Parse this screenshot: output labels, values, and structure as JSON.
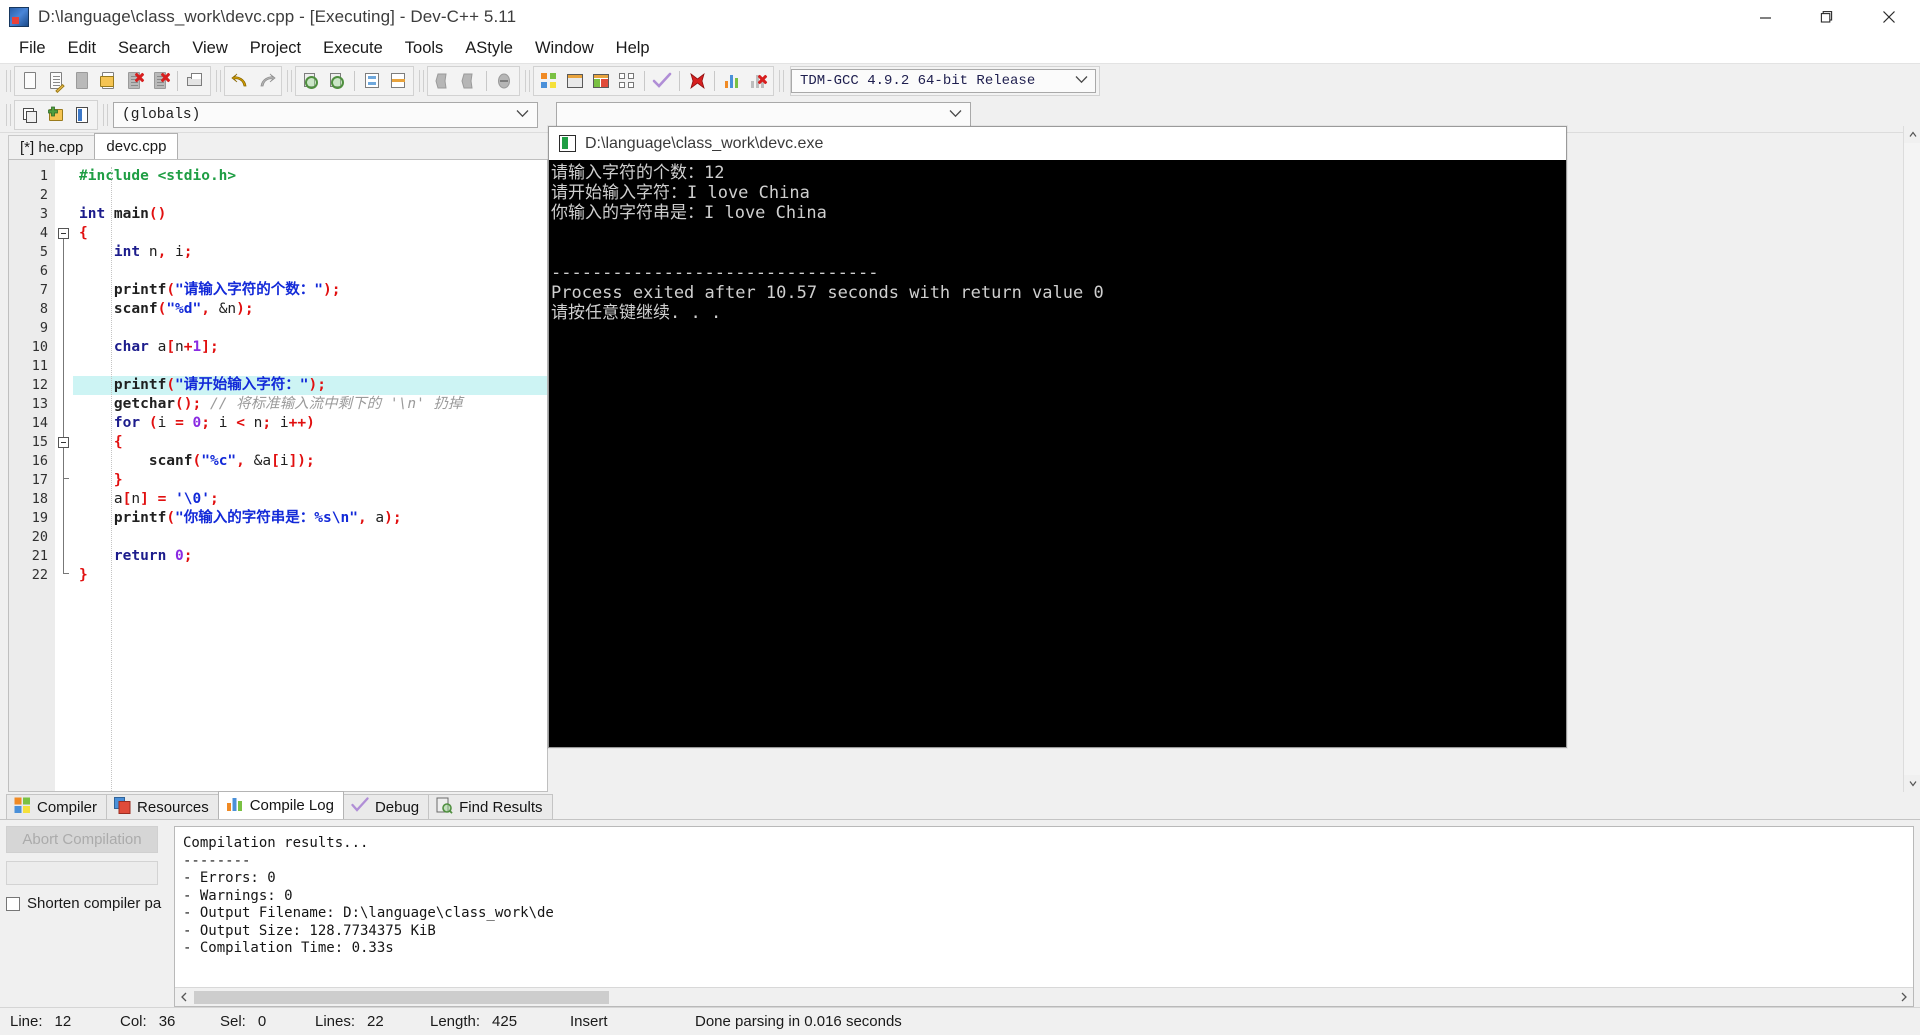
{
  "window": {
    "title": "D:\\language\\class_work\\devc.cpp - [Executing] - Dev-C++ 5.11",
    "app_icon": "devcpp-icon",
    "minimize": "minimize-icon",
    "maximize": "restore-icon",
    "close": "close-icon"
  },
  "menu": {
    "items": [
      "File",
      "Edit",
      "Search",
      "View",
      "Project",
      "Execute",
      "Tools",
      "AStyle",
      "Window",
      "Help"
    ]
  },
  "toolbar": {
    "groups": [
      {
        "buttons": [
          {
            "name": "new-file-icon"
          },
          {
            "name": "open-file-icon"
          },
          {
            "name": "save-file-icon"
          },
          {
            "name": "save-as-icon"
          },
          {
            "name": "close-file-icon"
          },
          {
            "name": "close-all-icon"
          },
          {
            "name": "print-icon"
          }
        ]
      },
      {
        "buttons": [
          {
            "name": "undo-icon"
          },
          {
            "name": "redo-icon"
          }
        ]
      },
      {
        "buttons": [
          {
            "name": "find-icon"
          },
          {
            "name": "replace-icon"
          },
          {
            "name": "goto-line-icon"
          },
          {
            "name": "toggle-breakpoint-icon"
          }
        ]
      },
      {
        "buttons": [
          {
            "name": "back-icon"
          },
          {
            "name": "forward-icon"
          },
          {
            "name": "insert-icon"
          }
        ]
      },
      {
        "buttons": [
          {
            "name": "compile-icon"
          },
          {
            "name": "run-icon"
          },
          {
            "name": "compile-run-icon"
          },
          {
            "name": "rebuild-all-icon"
          },
          {
            "name": "syntax-check-icon"
          },
          {
            "name": "stop-execution-icon"
          },
          {
            "name": "profile-icon"
          },
          {
            "name": "delete-profile-icon"
          }
        ]
      }
    ],
    "compiler_select": {
      "value": "TDM-GCC 4.9.2 64-bit Release",
      "chevron": "chevron-down-icon"
    }
  },
  "toolbar2": {
    "buttons": [
      {
        "name": "project-manager-icon"
      },
      {
        "name": "add-to-project-icon"
      },
      {
        "name": "class-browser-icon"
      }
    ],
    "scope_select": {
      "value": "(globals)",
      "chevron": "chevron-down-icon"
    },
    "member_select": {
      "value": "",
      "chevron": "chevron-down-icon"
    }
  },
  "editor": {
    "tabs": [
      {
        "label": "[*] he.cpp",
        "active": false
      },
      {
        "label": "devc.cpp",
        "active": true
      }
    ],
    "highlighted_line": 12,
    "total_lines": 22,
    "lines": [
      {
        "n": 1,
        "tokens": [
          {
            "t": "#include <stdio.h>",
            "c": "pp"
          }
        ]
      },
      {
        "n": 2,
        "tokens": []
      },
      {
        "n": 3,
        "tokens": [
          {
            "t": "int",
            "c": "k"
          },
          {
            "t": " main",
            "c": "fn"
          },
          {
            "t": "()",
            "c": "pun"
          }
        ]
      },
      {
        "n": 4,
        "tokens": [
          {
            "t": "{",
            "c": "pun"
          }
        ],
        "fold": "start"
      },
      {
        "n": 5,
        "tokens": [
          {
            "t": "    ",
            "c": "id"
          },
          {
            "t": "int",
            "c": "k"
          },
          {
            "t": " n",
            "c": "id"
          },
          {
            "t": ",",
            "c": "pun"
          },
          {
            "t": " i",
            "c": "id"
          },
          {
            "t": ";",
            "c": "pun"
          }
        ]
      },
      {
        "n": 6,
        "tokens": []
      },
      {
        "n": 7,
        "tokens": [
          {
            "t": "    printf",
            "c": "fn"
          },
          {
            "t": "(",
            "c": "pun"
          },
          {
            "t": "\"请输入字符的个数：\"",
            "c": "str"
          },
          {
            "t": ");",
            "c": "pun"
          }
        ]
      },
      {
        "n": 8,
        "tokens": [
          {
            "t": "    scanf",
            "c": "fn"
          },
          {
            "t": "(",
            "c": "pun"
          },
          {
            "t": "\"%d\"",
            "c": "str"
          },
          {
            "t": ",",
            "c": "pun"
          },
          {
            "t": " &n",
            "c": "id"
          },
          {
            "t": ");",
            "c": "pun"
          }
        ]
      },
      {
        "n": 9,
        "tokens": []
      },
      {
        "n": 10,
        "tokens": [
          {
            "t": "    ",
            "c": "id"
          },
          {
            "t": "char",
            "c": "k"
          },
          {
            "t": " a",
            "c": "id"
          },
          {
            "t": "[",
            "c": "pun"
          },
          {
            "t": "n",
            "c": "id"
          },
          {
            "t": "+",
            "c": "pun"
          },
          {
            "t": "1",
            "c": "num"
          },
          {
            "t": "];",
            "c": "pun"
          }
        ]
      },
      {
        "n": 11,
        "tokens": []
      },
      {
        "n": 12,
        "tokens": [
          {
            "t": "    printf",
            "c": "fn"
          },
          {
            "t": "(",
            "c": "pun"
          },
          {
            "t": "\"请开始输入字符：\"",
            "c": "str"
          },
          {
            "t": ");",
            "c": "pun"
          }
        ]
      },
      {
        "n": 13,
        "tokens": [
          {
            "t": "    getchar",
            "c": "fn"
          },
          {
            "t": "();",
            "c": "pun"
          },
          {
            "t": " // 将标准输入流中剩下的 '\\n' 扔掉",
            "c": "cm"
          }
        ]
      },
      {
        "n": 14,
        "tokens": [
          {
            "t": "    ",
            "c": "id"
          },
          {
            "t": "for",
            "c": "k"
          },
          {
            "t": " (",
            "c": "pun"
          },
          {
            "t": "i ",
            "c": "id"
          },
          {
            "t": "=",
            "c": "pun"
          },
          {
            "t": " ",
            "c": "id"
          },
          {
            "t": "0",
            "c": "num"
          },
          {
            "t": ";",
            "c": "pun"
          },
          {
            "t": " i ",
            "c": "id"
          },
          {
            "t": "<",
            "c": "pun"
          },
          {
            "t": " n",
            "c": "id"
          },
          {
            "t": ";",
            "c": "pun"
          },
          {
            "t": " i",
            "c": "id"
          },
          {
            "t": "++)",
            "c": "pun"
          }
        ]
      },
      {
        "n": 15,
        "tokens": [
          {
            "t": "    ",
            "c": "id"
          },
          {
            "t": "{",
            "c": "pun"
          }
        ],
        "fold": "start"
      },
      {
        "n": 16,
        "tokens": [
          {
            "t": "        scanf",
            "c": "fn"
          },
          {
            "t": "(",
            "c": "pun"
          },
          {
            "t": "\"%c\"",
            "c": "str"
          },
          {
            "t": ",",
            "c": "pun"
          },
          {
            "t": " &a",
            "c": "id"
          },
          {
            "t": "[",
            "c": "pun"
          },
          {
            "t": "i",
            "c": "id"
          },
          {
            "t": "]);",
            "c": "pun"
          }
        ]
      },
      {
        "n": 17,
        "tokens": [
          {
            "t": "    ",
            "c": "id"
          },
          {
            "t": "}",
            "c": "pun"
          }
        ],
        "fold": "end"
      },
      {
        "n": 18,
        "tokens": [
          {
            "t": "    a",
            "c": "id"
          },
          {
            "t": "[",
            "c": "pun"
          },
          {
            "t": "n",
            "c": "id"
          },
          {
            "t": "]",
            "c": "pun"
          },
          {
            "t": " ",
            "c": "id"
          },
          {
            "t": "=",
            "c": "pun"
          },
          {
            "t": " ",
            "c": "id"
          },
          {
            "t": "'\\0'",
            "c": "str"
          },
          {
            "t": ";",
            "c": "pun"
          }
        ]
      },
      {
        "n": 19,
        "tokens": [
          {
            "t": "    printf",
            "c": "fn"
          },
          {
            "t": "(",
            "c": "pun"
          },
          {
            "t": "\"你输入的字符串是：%s\\n\"",
            "c": "str"
          },
          {
            "t": ",",
            "c": "pun"
          },
          {
            "t": " a",
            "c": "id"
          },
          {
            "t": ");",
            "c": "pun"
          }
        ]
      },
      {
        "n": 20,
        "tokens": []
      },
      {
        "n": 21,
        "tokens": [
          {
            "t": "    ",
            "c": "id"
          },
          {
            "t": "return",
            "c": "k"
          },
          {
            "t": " ",
            "c": "id"
          },
          {
            "t": "0",
            "c": "num"
          },
          {
            "t": ";",
            "c": "pun"
          }
        ]
      },
      {
        "n": 22,
        "tokens": [
          {
            "t": "}",
            "c": "pun"
          }
        ],
        "fold": "end"
      }
    ]
  },
  "console": {
    "title": "D:\\language\\class_work\\devc.exe",
    "icon": "console-window-icon",
    "output": "请输入字符的个数：12\n请开始输入字符：I love China\n你输入的字符串是：I love China\n\n\n--------------------------------\nProcess exited after 10.57 seconds with return value 0\n请按任意键继续. . ."
  },
  "bottom_panel": {
    "tabs": [
      {
        "label": "Compiler",
        "icon": "compiler-icon",
        "active": false
      },
      {
        "label": "Resources",
        "icon": "resources-icon",
        "active": false
      },
      {
        "label": "Compile Log",
        "icon": "compile-log-icon",
        "active": true
      },
      {
        "label": "Debug",
        "icon": "debug-icon",
        "active": false
      },
      {
        "label": "Find Results",
        "icon": "find-results-icon",
        "active": false
      }
    ],
    "abort_button": "Abort Compilation",
    "shorten_checkbox": {
      "label": "Shorten compiler pa",
      "checked": false
    },
    "log": "Compilation results...\n--------\n- Errors: 0\n- Warnings: 0\n- Output Filename: D:\\language\\class_work\\de\n- Output Size: 128.7734375 KiB\n- Compilation Time: 0.33s"
  },
  "status_bar": {
    "line_label": "Line:",
    "line_value": "12",
    "col_label": "Col:",
    "col_value": "36",
    "sel_label": "Sel:",
    "sel_value": "0",
    "lines_label": "Lines:",
    "lines_value": "22",
    "length_label": "Length:",
    "length_value": "425",
    "mode": "Insert",
    "message": "Done parsing in 0.016 seconds"
  },
  "colors": {
    "accent": "#0078d7",
    "highlight_line": "#cdf4f4",
    "string": "#1229d8",
    "keyword": "#1c1c8c",
    "punctuation": "#e10f0f",
    "comment": "#9a9a9a",
    "preprocessor": "#1f9e44",
    "console_bg": "#000000",
    "console_fg": "#cfcfcf"
  }
}
